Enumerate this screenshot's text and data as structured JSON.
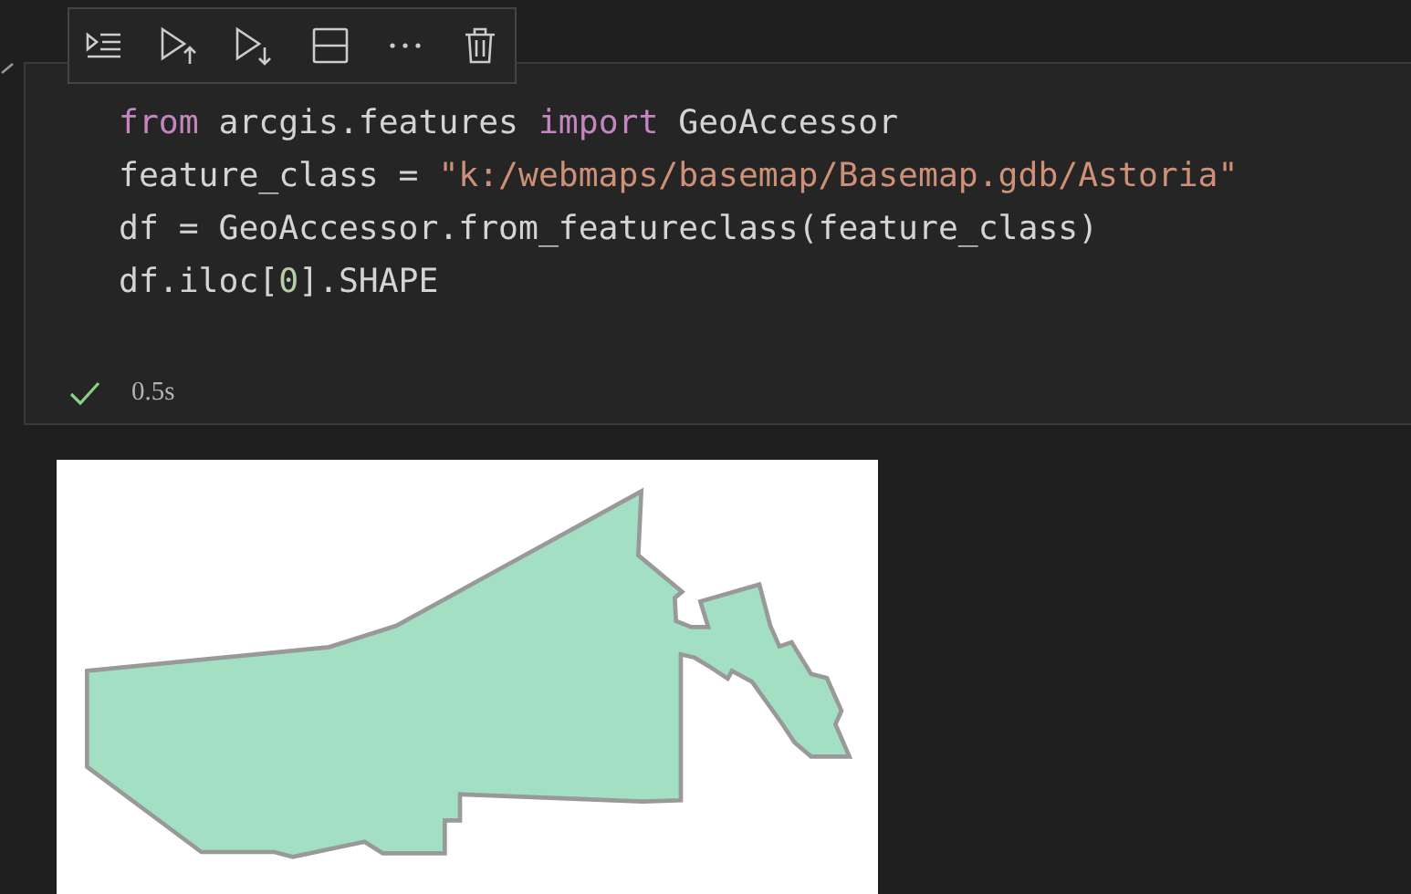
{
  "cell": {
    "code_lines": [
      [
        {
          "kind": "keyword",
          "text": "from"
        },
        {
          "kind": "plain",
          "text": " arcgis.features "
        },
        {
          "kind": "keyword",
          "text": "import"
        },
        {
          "kind": "plain",
          "text": " GeoAccessor"
        }
      ],
      [
        {
          "kind": "plain",
          "text": "feature_class = "
        },
        {
          "kind": "string",
          "text": "\"k:/webmaps/basemap/Basemap.gdb/Astoria\""
        }
      ],
      [
        {
          "kind": "plain",
          "text": "df = GeoAccessor.from_featureclass(feature_class)"
        }
      ],
      [
        {
          "kind": "plain",
          "text": "df.iloc["
        },
        {
          "kind": "number",
          "text": "0"
        },
        {
          "kind": "plain",
          "text": "].SHAPE"
        }
      ]
    ],
    "status": {
      "succeeded": true,
      "duration": "0.5s"
    }
  },
  "output": {
    "kind": "shape-plot"
  }
}
